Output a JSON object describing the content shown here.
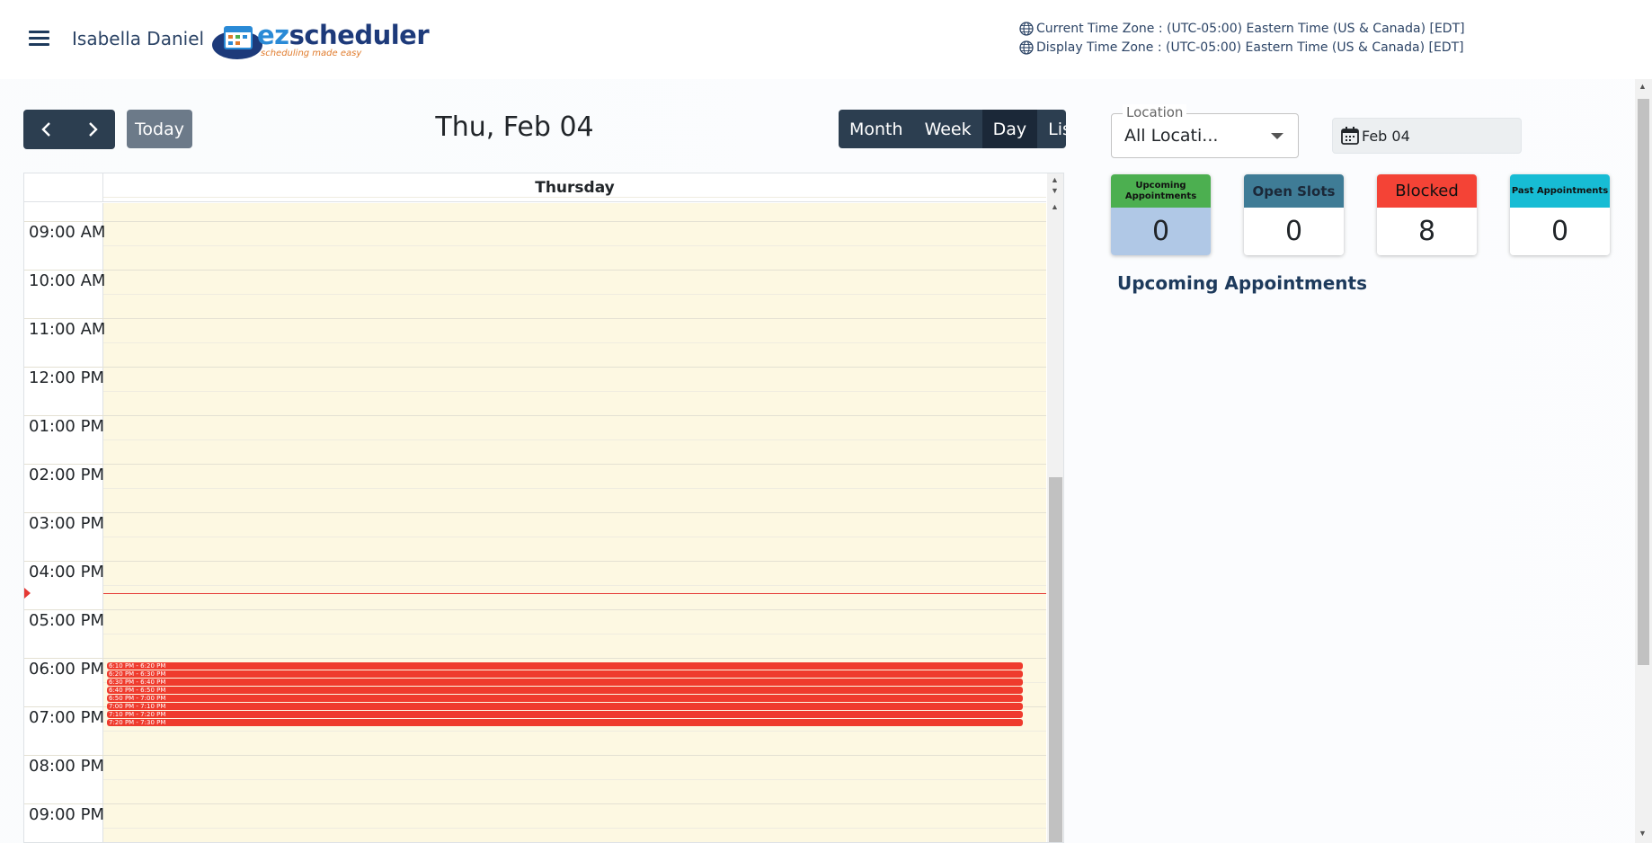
{
  "header": {
    "user_name": "Isabella Daniel",
    "logo_main": "scheduler",
    "logo_prefix": "ez",
    "logo_tagline": "scheduling made easy",
    "current_tz": "Current Time Zone : (UTC-05:00) Eastern Time (US & Canada) [EDT]",
    "display_tz": "Display Time Zone : (UTC-05:00) Eastern Time (US & Canada) [EDT]"
  },
  "toolbar": {
    "today_label": "Today",
    "date_title": "Thu, Feb 04",
    "views": [
      {
        "label": "Month",
        "active": false
      },
      {
        "label": "Week",
        "active": false
      },
      {
        "label": "Day",
        "active": true
      },
      {
        "label": "List",
        "active": false
      }
    ]
  },
  "calendar": {
    "day_header": "Thursday",
    "hours": [
      "09:00 AM",
      "10:00 AM",
      "11:00 AM",
      "12:00 PM",
      "01:00 PM",
      "02:00 PM",
      "03:00 PM",
      "04:00 PM",
      "05:00 PM",
      "06:00 PM",
      "07:00 PM",
      "08:00 PM",
      "09:00 PM"
    ],
    "events": [
      "6:10 PM - 6:20 PM",
      "6:20 PM - 6:30 PM",
      "6:30 PM - 6:40 PM",
      "6:40 PM - 6:50 PM",
      "6:50 PM - 7:00 PM",
      "7:00 PM - 7:10 PM",
      "7:10 PM - 7:20 PM",
      "7:20 PM - 7:30 PM"
    ],
    "event_color": "#ef3b2d"
  },
  "filters": {
    "location_label": "Location",
    "location_value": "All Locati...",
    "date_value": "Feb 04"
  },
  "stats": [
    {
      "label": "Upcoming Appointments",
      "value": "0",
      "header_color": "#4caf50",
      "body_color": "#b0c8e6"
    },
    {
      "label": "Open Slots",
      "value": "0",
      "header_color": "#3f7c96",
      "body_color": "#ffffff"
    },
    {
      "label": "Blocked",
      "value": "8",
      "header_color": "#f44336",
      "body_color": "#ffffff"
    },
    {
      "label": "Past Appointments",
      "value": "0",
      "header_color": "#17bcd4",
      "body_color": "#ffffff"
    }
  ],
  "upcoming": {
    "title": "Upcoming Appointments"
  }
}
